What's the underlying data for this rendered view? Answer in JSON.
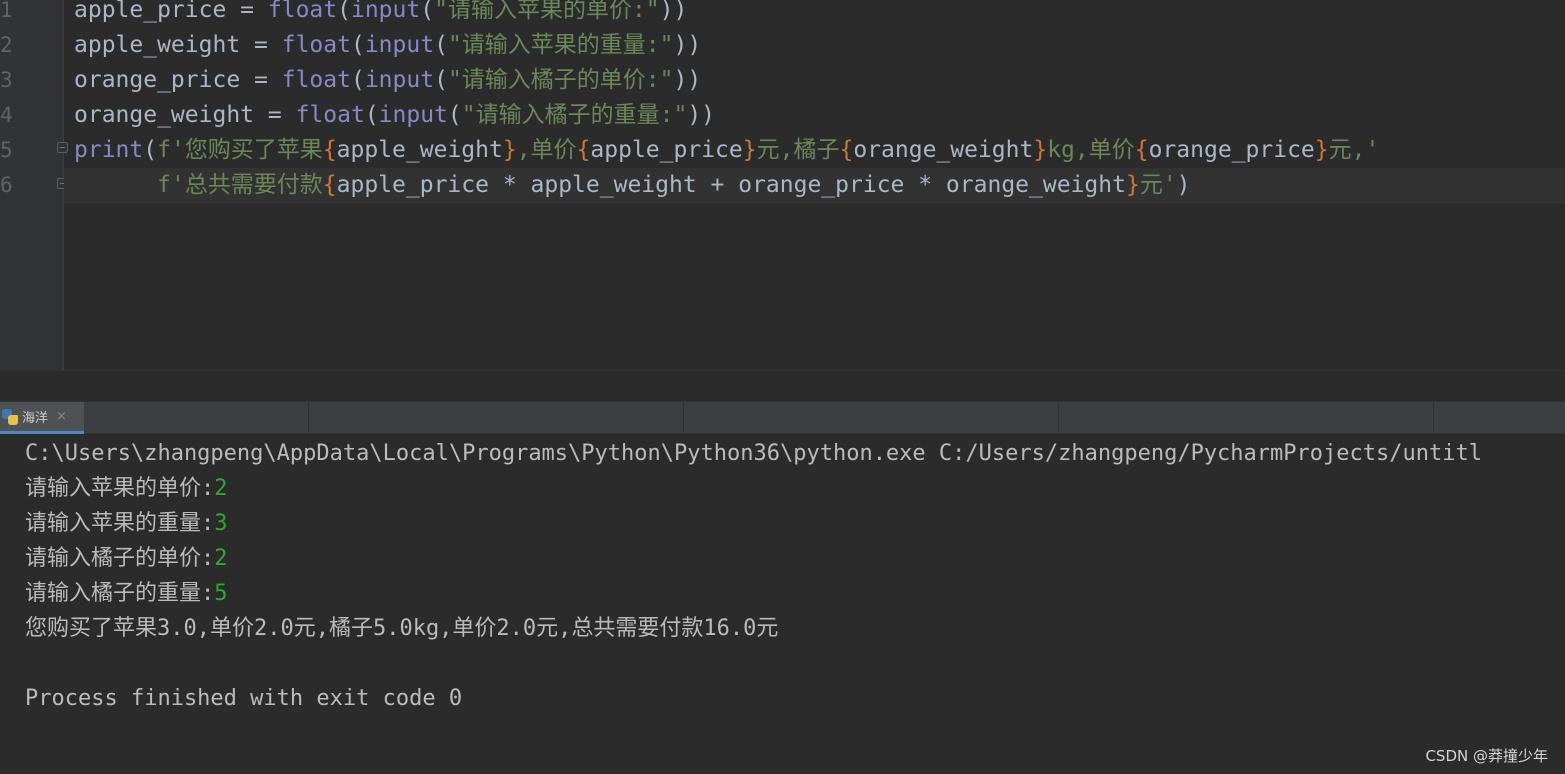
{
  "editor": {
    "line_numbers": [
      "1",
      "2",
      "3",
      "4",
      "5",
      "6"
    ],
    "lines": [
      {
        "var": "apple_price",
        "eq": " = ",
        "fn1": "float",
        "p1": "(",
        "fn2": "input",
        "p2": "(",
        "str": "\"请输入苹果的单价:\"",
        "close": "))"
      },
      {
        "var": "apple_weight",
        "eq": " = ",
        "fn1": "float",
        "p1": "(",
        "fn2": "input",
        "p2": "(",
        "str": "\"请输入苹果的重量:\"",
        "close": "))"
      },
      {
        "var": "orange_price",
        "eq": " = ",
        "fn1": "float",
        "p1": "(",
        "fn2": "input",
        "p2": "(",
        "str": "\"请输入橘子的单价:\"",
        "close": "))"
      },
      {
        "var": "orange_weight",
        "eq": " = ",
        "fn1": "float",
        "p1": "(",
        "fn2": "input",
        "p2": "(",
        "str": "\"请输入橘子的重量:\"",
        "close": "))"
      }
    ],
    "line5": {
      "fn": "print",
      "open": "(",
      "s1": "f'您购买了苹果",
      "b1o": "{",
      "e1": "apple_weight",
      "b1c": "}",
      "s2": ",单价",
      "b2o": "{",
      "e2": "apple_price",
      "b2c": "}",
      "s3": "元,橘子",
      "b3o": "{",
      "e3": "orange_weight",
      "b3c": "}",
      "s4": "kg,单价",
      "b4o": "{",
      "e4": "orange_price",
      "b4c": "}",
      "s5": "元,'"
    },
    "line6": {
      "indent": "      ",
      "s1": "f'总共需要付款",
      "bo": "{",
      "expr": "apple_price * apple_weight + orange_price * orange_weight",
      "bc": "}",
      "s2": "元'",
      "close": ")"
    }
  },
  "run_panel": {
    "tab_label": "海洋",
    "tab_close": "×"
  },
  "console": {
    "command": "C:\\Users\\zhangpeng\\AppData\\Local\\Programs\\Python\\Python36\\python.exe C:/Users/zhangpeng/PycharmProjects/untitl",
    "prompts": [
      {
        "prompt": "请输入苹果的单价:",
        "input": "2"
      },
      {
        "prompt": "请输入苹果的重量:",
        "input": "3"
      },
      {
        "prompt": "请输入橘子的单价:",
        "input": "2"
      },
      {
        "prompt": "请输入橘子的重量:",
        "input": "5"
      }
    ],
    "result": "您购买了苹果3.0,单价2.0元,橘子5.0kg,单价2.0元,总共需要付款16.0元",
    "exit_message": "Process finished with exit code 0"
  },
  "watermark": "CSDN @莽撞少年",
  "colors": {
    "background": "#2b2b2b",
    "keyword_builtin": "#8888c6",
    "string": "#6a8759",
    "brace": "#cc7832",
    "console_input": "#2fa82f",
    "tab_accent": "#4a88c7"
  }
}
